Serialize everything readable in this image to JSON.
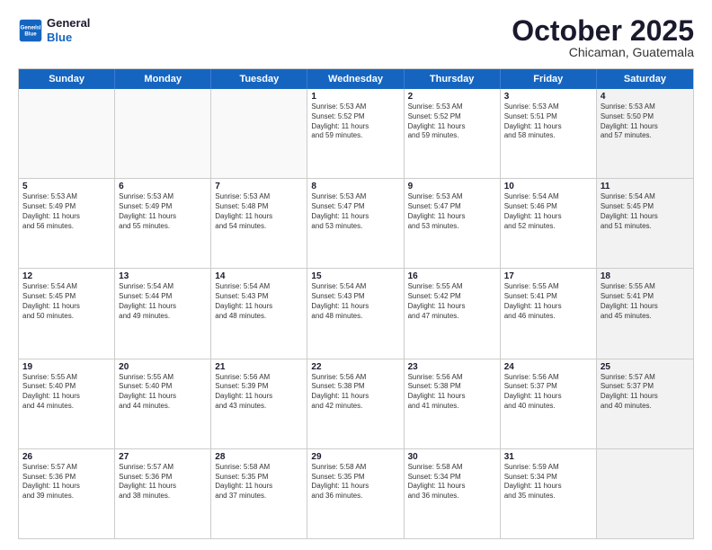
{
  "header": {
    "logo_line1": "General",
    "logo_line2": "Blue",
    "title": "October 2025",
    "location": "Chicaman, Guatemala"
  },
  "days_of_week": [
    "Sunday",
    "Monday",
    "Tuesday",
    "Wednesday",
    "Thursday",
    "Friday",
    "Saturday"
  ],
  "weeks": [
    [
      {
        "day": "",
        "text": "",
        "empty": true
      },
      {
        "day": "",
        "text": "",
        "empty": true
      },
      {
        "day": "",
        "text": "",
        "empty": true
      },
      {
        "day": "1",
        "text": "Sunrise: 5:53 AM\nSunset: 5:52 PM\nDaylight: 11 hours\nand 59 minutes."
      },
      {
        "day": "2",
        "text": "Sunrise: 5:53 AM\nSunset: 5:52 PM\nDaylight: 11 hours\nand 59 minutes."
      },
      {
        "day": "3",
        "text": "Sunrise: 5:53 AM\nSunset: 5:51 PM\nDaylight: 11 hours\nand 58 minutes."
      },
      {
        "day": "4",
        "text": "Sunrise: 5:53 AM\nSunset: 5:50 PM\nDaylight: 11 hours\nand 57 minutes.",
        "shaded": true
      }
    ],
    [
      {
        "day": "5",
        "text": "Sunrise: 5:53 AM\nSunset: 5:49 PM\nDaylight: 11 hours\nand 56 minutes."
      },
      {
        "day": "6",
        "text": "Sunrise: 5:53 AM\nSunset: 5:49 PM\nDaylight: 11 hours\nand 55 minutes."
      },
      {
        "day": "7",
        "text": "Sunrise: 5:53 AM\nSunset: 5:48 PM\nDaylight: 11 hours\nand 54 minutes."
      },
      {
        "day": "8",
        "text": "Sunrise: 5:53 AM\nSunset: 5:47 PM\nDaylight: 11 hours\nand 53 minutes."
      },
      {
        "day": "9",
        "text": "Sunrise: 5:53 AM\nSunset: 5:47 PM\nDaylight: 11 hours\nand 53 minutes."
      },
      {
        "day": "10",
        "text": "Sunrise: 5:54 AM\nSunset: 5:46 PM\nDaylight: 11 hours\nand 52 minutes."
      },
      {
        "day": "11",
        "text": "Sunrise: 5:54 AM\nSunset: 5:45 PM\nDaylight: 11 hours\nand 51 minutes.",
        "shaded": true
      }
    ],
    [
      {
        "day": "12",
        "text": "Sunrise: 5:54 AM\nSunset: 5:45 PM\nDaylight: 11 hours\nand 50 minutes."
      },
      {
        "day": "13",
        "text": "Sunrise: 5:54 AM\nSunset: 5:44 PM\nDaylight: 11 hours\nand 49 minutes."
      },
      {
        "day": "14",
        "text": "Sunrise: 5:54 AM\nSunset: 5:43 PM\nDaylight: 11 hours\nand 48 minutes."
      },
      {
        "day": "15",
        "text": "Sunrise: 5:54 AM\nSunset: 5:43 PM\nDaylight: 11 hours\nand 48 minutes."
      },
      {
        "day": "16",
        "text": "Sunrise: 5:55 AM\nSunset: 5:42 PM\nDaylight: 11 hours\nand 47 minutes."
      },
      {
        "day": "17",
        "text": "Sunrise: 5:55 AM\nSunset: 5:41 PM\nDaylight: 11 hours\nand 46 minutes."
      },
      {
        "day": "18",
        "text": "Sunrise: 5:55 AM\nSunset: 5:41 PM\nDaylight: 11 hours\nand 45 minutes.",
        "shaded": true
      }
    ],
    [
      {
        "day": "19",
        "text": "Sunrise: 5:55 AM\nSunset: 5:40 PM\nDaylight: 11 hours\nand 44 minutes."
      },
      {
        "day": "20",
        "text": "Sunrise: 5:55 AM\nSunset: 5:40 PM\nDaylight: 11 hours\nand 44 minutes."
      },
      {
        "day": "21",
        "text": "Sunrise: 5:56 AM\nSunset: 5:39 PM\nDaylight: 11 hours\nand 43 minutes."
      },
      {
        "day": "22",
        "text": "Sunrise: 5:56 AM\nSunset: 5:38 PM\nDaylight: 11 hours\nand 42 minutes."
      },
      {
        "day": "23",
        "text": "Sunrise: 5:56 AM\nSunset: 5:38 PM\nDaylight: 11 hours\nand 41 minutes."
      },
      {
        "day": "24",
        "text": "Sunrise: 5:56 AM\nSunset: 5:37 PM\nDaylight: 11 hours\nand 40 minutes."
      },
      {
        "day": "25",
        "text": "Sunrise: 5:57 AM\nSunset: 5:37 PM\nDaylight: 11 hours\nand 40 minutes.",
        "shaded": true
      }
    ],
    [
      {
        "day": "26",
        "text": "Sunrise: 5:57 AM\nSunset: 5:36 PM\nDaylight: 11 hours\nand 39 minutes."
      },
      {
        "day": "27",
        "text": "Sunrise: 5:57 AM\nSunset: 5:36 PM\nDaylight: 11 hours\nand 38 minutes."
      },
      {
        "day": "28",
        "text": "Sunrise: 5:58 AM\nSunset: 5:35 PM\nDaylight: 11 hours\nand 37 minutes."
      },
      {
        "day": "29",
        "text": "Sunrise: 5:58 AM\nSunset: 5:35 PM\nDaylight: 11 hours\nand 36 minutes."
      },
      {
        "day": "30",
        "text": "Sunrise: 5:58 AM\nSunset: 5:34 PM\nDaylight: 11 hours\nand 36 minutes."
      },
      {
        "day": "31",
        "text": "Sunrise: 5:59 AM\nSunset: 5:34 PM\nDaylight: 11 hours\nand 35 minutes."
      },
      {
        "day": "",
        "text": "",
        "empty": true,
        "shaded": true
      }
    ]
  ]
}
